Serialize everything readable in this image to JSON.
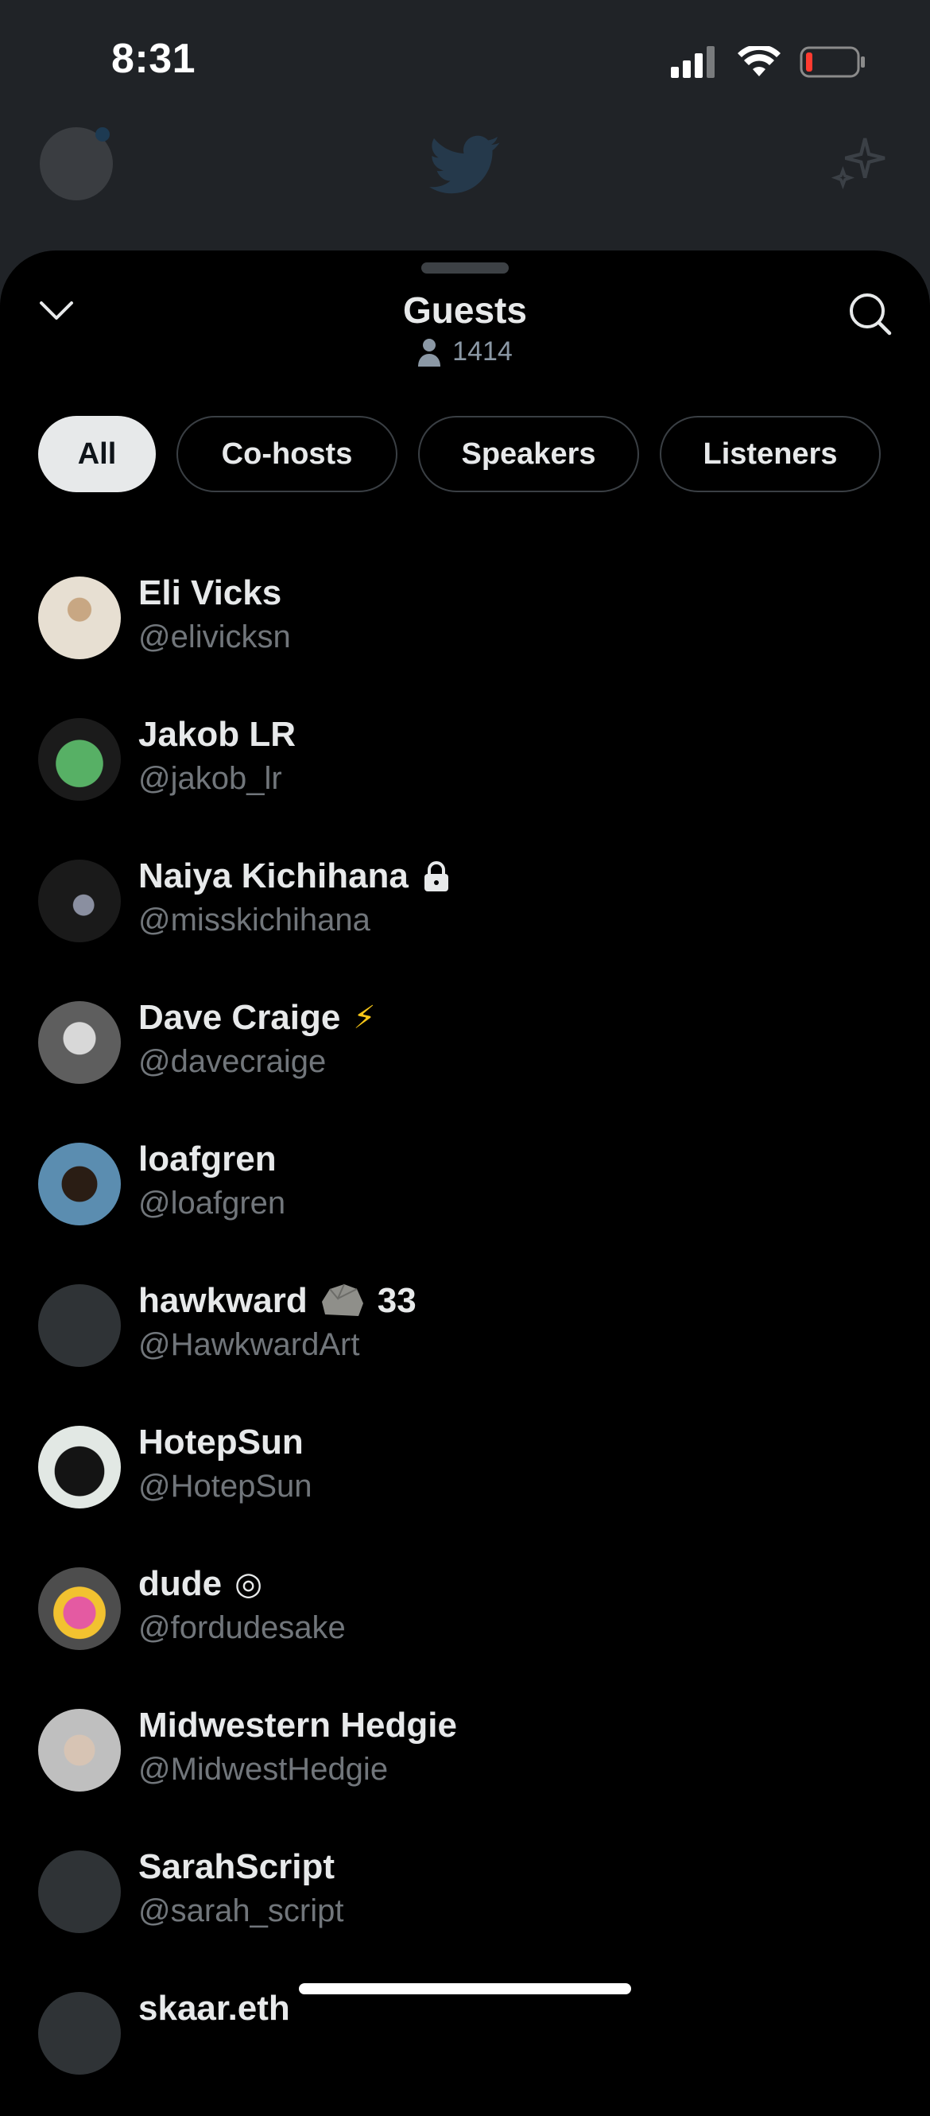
{
  "status_bar": {
    "time": "8:31"
  },
  "header": {
    "title": "Guests",
    "count": "1414"
  },
  "tabs": [
    {
      "label": "All",
      "active": true
    },
    {
      "label": "Co-hosts",
      "active": false
    },
    {
      "label": "Speakers",
      "active": false
    },
    {
      "label": "Listeners",
      "active": false
    }
  ],
  "guests": [
    {
      "name": "Eli Vicks",
      "handle": "@elivicksn",
      "badge": "",
      "avatar_color": "#d9c8b4"
    },
    {
      "name": "Jakob LR",
      "handle": "@jakob_lr",
      "badge": "",
      "avatar_color": "#4fa65a"
    },
    {
      "name": "Naiya Kichihana",
      "handle": "@misskichihana",
      "badge": "lock-icon",
      "avatar_color": "#2a2a2a"
    },
    {
      "name": "Dave Craige",
      "handle": "@davecraige",
      "badge": "⚡",
      "avatar_color": "#9a9a9a"
    },
    {
      "name": "loafgren",
      "handle": "@loafgren",
      "badge": "",
      "avatar_color": "#4f7ea0"
    },
    {
      "name": "hawkward",
      "handle": "@HawkwardArt",
      "badge": "rock-emoji",
      "suffix": "33",
      "avatar_color": "#2f3336"
    },
    {
      "name": "HotepSun",
      "handle": "@HotepSun",
      "badge": "",
      "avatar_color": "#6b7d66"
    },
    {
      "name": "dude",
      "handle": "@fordudesake",
      "badge": "◎",
      "avatar_color": "#d04a8a"
    },
    {
      "name": "Midwestern Hedgie",
      "handle": "@MidwestHedgie",
      "badge": "",
      "avatar_color": "#c9c9c9"
    },
    {
      "name": "SarahScript",
      "handle": "@sarah_script",
      "badge": "",
      "avatar_color": "#2f3336"
    },
    {
      "name": "skaar.eth",
      "handle": "",
      "badge": "",
      "avatar_color": "#2f3336"
    }
  ]
}
